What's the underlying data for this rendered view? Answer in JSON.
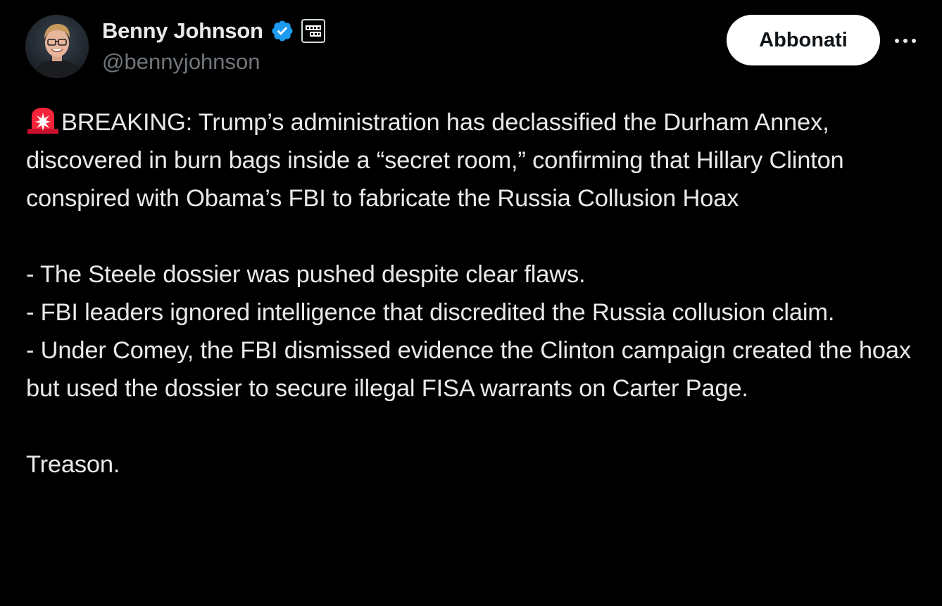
{
  "author": {
    "display_name": "Benny Johnson",
    "handle": "@bennyjohnson",
    "verified": true,
    "verified_color": "#1d9bf0",
    "avatar_icon": "profile-photo",
    "affiliate_icon": "affiliate-logo-badge"
  },
  "actions": {
    "subscribe_label": "Abbonati",
    "more_icon": "more-horizontal-icon"
  },
  "post": {
    "lead_icon": "police-siren-emoji",
    "paragraphs": [
      "BREAKING: Trump’s administration has declassified the Durham Annex, discovered in burn bags inside a “secret room,” confirming that Hillary Clinton conspired with Obama’s FBI to fabricate the Russia Collusion Hoax",
      "",
      "- The Steele dossier was pushed despite clear flaws.",
      "- FBI leaders ignored intelligence that discredited the Russia collusion claim.",
      "- Under Comey, the FBI dismissed evidence the Clinton campaign created the hoax but used the dossier to secure illegal FISA warrants on Carter Page.",
      "",
      "Treason."
    ]
  },
  "colors": {
    "background": "#000000",
    "text_primary": "#e7e9ea",
    "text_secondary": "#71767b",
    "siren_red": "#f4243a"
  }
}
